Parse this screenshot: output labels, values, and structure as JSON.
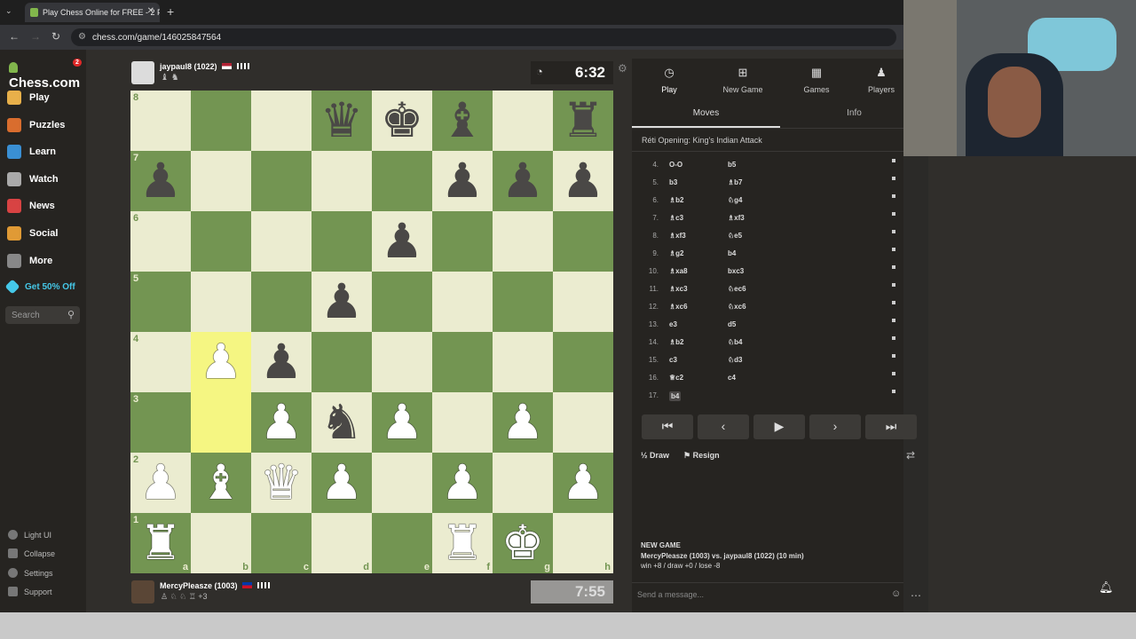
{
  "browser": {
    "tab_title": "Play Chess Online for FREE - 2 Pl",
    "url": "chess.com/game/146025847564"
  },
  "sidebar": {
    "logo": "Chess.com",
    "logo_badge": "2",
    "items": [
      {
        "label": "Play",
        "icon": "play-icon",
        "color": "#e8b04a"
      },
      {
        "label": "Puzzles",
        "icon": "puzzle-icon",
        "color": "#d96d2e"
      },
      {
        "label": "Learn",
        "icon": "learn-icon",
        "color": "#3a8fd3"
      },
      {
        "label": "Watch",
        "icon": "binoculars-icon",
        "color": "#aaaaaa"
      },
      {
        "label": "News",
        "icon": "news-icon",
        "color": "#d84343"
      },
      {
        "label": "Social",
        "icon": "social-icon",
        "color": "#e09a35"
      },
      {
        "label": "More",
        "icon": "more-icon",
        "color": "#888888"
      }
    ],
    "promo": "Get 50% Off",
    "search_placeholder": "Search",
    "footer": [
      "Light UI",
      "Collapse",
      "Settings",
      "Support"
    ]
  },
  "top_player": {
    "name": "jaypaul8 (1022)",
    "clock": "6:32"
  },
  "bottom_player": {
    "name": "MercyPleasze (1003)",
    "captured_extra": "+3",
    "clock": "7:55"
  },
  "board": {
    "ranks": [
      "8",
      "7",
      "6",
      "5",
      "4",
      "3",
      "2",
      "1"
    ],
    "files": [
      "a",
      "b",
      "c",
      "d",
      "e",
      "f",
      "g",
      "h"
    ],
    "highlight_color": "#f5f682",
    "light_color": "#ebecd0",
    "dark_color": "#739552",
    "pieces": [
      {
        "sq": "d8",
        "glyph": "♛",
        "color": "b"
      },
      {
        "sq": "e8",
        "glyph": "♚",
        "color": "b"
      },
      {
        "sq": "f8",
        "glyph": "♝",
        "color": "b"
      },
      {
        "sq": "h8",
        "glyph": "♜",
        "color": "b"
      },
      {
        "sq": "a7",
        "glyph": "♟",
        "color": "b"
      },
      {
        "sq": "f7",
        "glyph": "♟",
        "color": "b"
      },
      {
        "sq": "g7",
        "glyph": "♟",
        "color": "b"
      },
      {
        "sq": "h7",
        "glyph": "♟",
        "color": "b"
      },
      {
        "sq": "e6",
        "glyph": "♟",
        "color": "b"
      },
      {
        "sq": "d5",
        "glyph": "♟",
        "color": "b"
      },
      {
        "sq": "b4",
        "glyph": "♟",
        "color": "w"
      },
      {
        "sq": "c4",
        "glyph": "♟",
        "color": "b"
      },
      {
        "sq": "c3",
        "glyph": "♟",
        "color": "w"
      },
      {
        "sq": "d3",
        "glyph": "♞",
        "color": "b"
      },
      {
        "sq": "e3",
        "glyph": "♟",
        "color": "w"
      },
      {
        "sq": "g3",
        "glyph": "♟",
        "color": "w"
      },
      {
        "sq": "a2",
        "glyph": "♟",
        "color": "w"
      },
      {
        "sq": "b2",
        "glyph": "♝",
        "color": "w"
      },
      {
        "sq": "c2",
        "glyph": "♛",
        "color": "w"
      },
      {
        "sq": "d2",
        "glyph": "♟",
        "color": "w"
      },
      {
        "sq": "f2",
        "glyph": "♟",
        "color": "w"
      },
      {
        "sq": "h2",
        "glyph": "♟",
        "color": "w"
      },
      {
        "sq": "a1",
        "glyph": "♜",
        "color": "w"
      },
      {
        "sq": "f1",
        "glyph": "♜",
        "color": "w"
      },
      {
        "sq": "g1",
        "glyph": "♚",
        "color": "w"
      }
    ],
    "highlights": [
      "b3",
      "b4"
    ]
  },
  "right_panel": {
    "tabs": [
      {
        "label": "Play",
        "icon": "play-clock-icon"
      },
      {
        "label": "New Game",
        "icon": "plus-icon"
      },
      {
        "label": "Games",
        "icon": "board-icon"
      },
      {
        "label": "Players",
        "icon": "players-icon"
      }
    ],
    "subtabs": [
      "Moves",
      "Info"
    ],
    "opening": "Réti Opening: King's Indian Attack",
    "moves": [
      {
        "n": "4.",
        "w": "O-O",
        "b": "b5"
      },
      {
        "n": "5.",
        "w": "b3",
        "b": "♗b7"
      },
      {
        "n": "6.",
        "w": "♗b2",
        "b": "♘g4"
      },
      {
        "n": "7.",
        "w": "♗c3",
        "b": "♗xf3"
      },
      {
        "n": "8.",
        "w": "♗xf3",
        "b": "♘e5"
      },
      {
        "n": "9.",
        "w": "♗g2",
        "b": "b4"
      },
      {
        "n": "10.",
        "w": "♗xa8",
        "b": "bxc3"
      },
      {
        "n": "11.",
        "w": "♗xc3",
        "b": "♘ec6"
      },
      {
        "n": "12.",
        "w": "♗xc6",
        "b": "♘xc6"
      },
      {
        "n": "13.",
        "w": "e3",
        "b": "d5"
      },
      {
        "n": "14.",
        "w": "♗b2",
        "b": "♘b4"
      },
      {
        "n": "15.",
        "w": "c3",
        "b": "♘d3"
      },
      {
        "n": "16.",
        "w": "♕c2",
        "b": "c4"
      },
      {
        "n": "17.",
        "w": "b4",
        "b": ""
      }
    ],
    "controls": [
      "first-move-icon",
      "prev-move-icon",
      "play-icon",
      "next-move-icon",
      "last-move-icon"
    ],
    "draw_label": "Draw",
    "resign_label": "Resign",
    "new_game_title": "NEW GAME",
    "new_game_line": "MercyPleasze (1003) vs. jaypaul8 (1022) (10 min)",
    "new_game_result": "win +8 / draw +0 / lose -8",
    "message_placeholder": "Send a message..."
  }
}
